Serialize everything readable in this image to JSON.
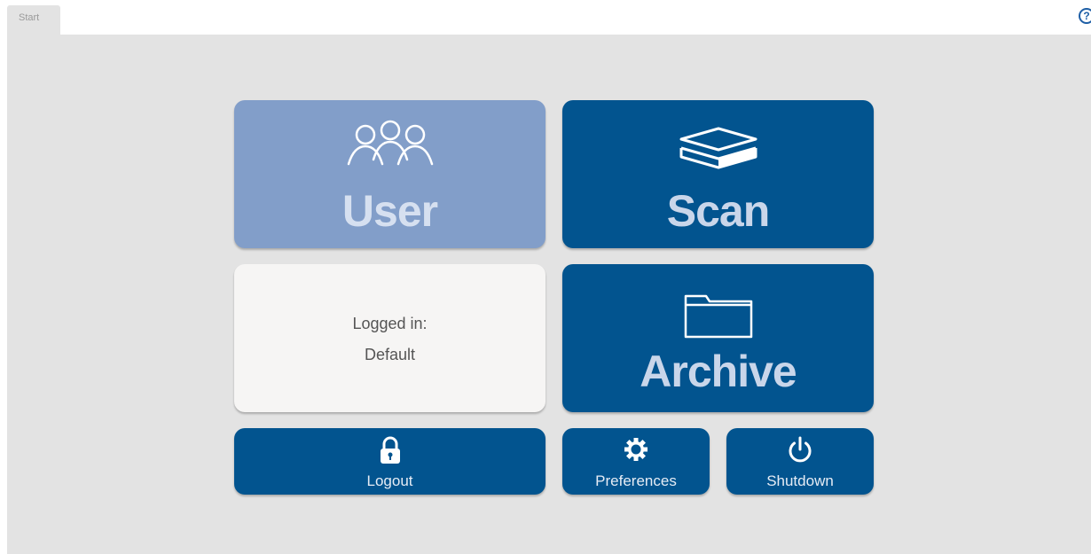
{
  "tabs": [
    {
      "label": "Start"
    }
  ],
  "help": {
    "icon": "help-icon",
    "glyph": "?"
  },
  "tiles": {
    "user": {
      "label": "User",
      "icon": "users-icon"
    },
    "scan": {
      "label": "Scan",
      "icon": "scanner-icon"
    },
    "logged_in": {
      "line1": "Logged in:",
      "line2": "Default"
    },
    "archive": {
      "label": "Archive",
      "icon": "folder-icon"
    },
    "logout": {
      "label": "Logout",
      "icon": "lock-icon"
    },
    "preferences": {
      "label": "Preferences",
      "icon": "gear-icon"
    },
    "shutdown": {
      "label": "Shutdown",
      "icon": "power-icon"
    }
  },
  "colors": {
    "primary": "#02548f",
    "user_tile": "#829ec9",
    "info_tile": "#f6f5f4",
    "background": "#e3e3e3"
  }
}
